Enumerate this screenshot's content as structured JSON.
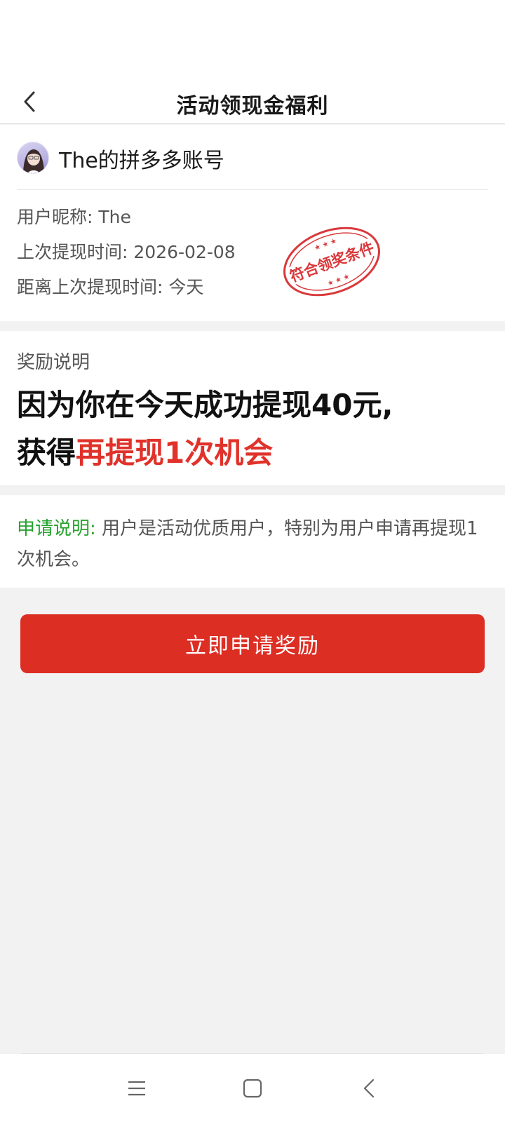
{
  "nav": {
    "title": "活动领现金福利",
    "back_icon": "chevron-left-icon"
  },
  "account": {
    "name": "The的拼多多账号",
    "nickname_label": "用户昵称:",
    "nickname_value": "The",
    "last_withdraw_label": "上次提现时间:",
    "last_withdraw_value": "2026-02-08",
    "since_label": "距离上次提现时间:",
    "since_value": "今天",
    "stamp_text": "符合领奖条件"
  },
  "reward": {
    "label": "奖励说明",
    "line1": "因为你在今天成功提现40元,",
    "line2_prefix": "获得",
    "line2_highlight": "再提现1次机会"
  },
  "apply": {
    "lead": "申请说明:",
    "text": "用户是活动优质用户，特别为用户申请再提现1次机会。"
  },
  "cta": {
    "label": "立即申请奖励"
  },
  "colors": {
    "accent_red": "#dd2e24",
    "highlight_red": "#e0322a",
    "lead_green": "#27a22e",
    "background": "#f2f2f2"
  },
  "system_nav": {
    "menu_icon": "menu-icon",
    "home_icon": "square-home-icon",
    "back_icon": "triangle-back-icon"
  }
}
